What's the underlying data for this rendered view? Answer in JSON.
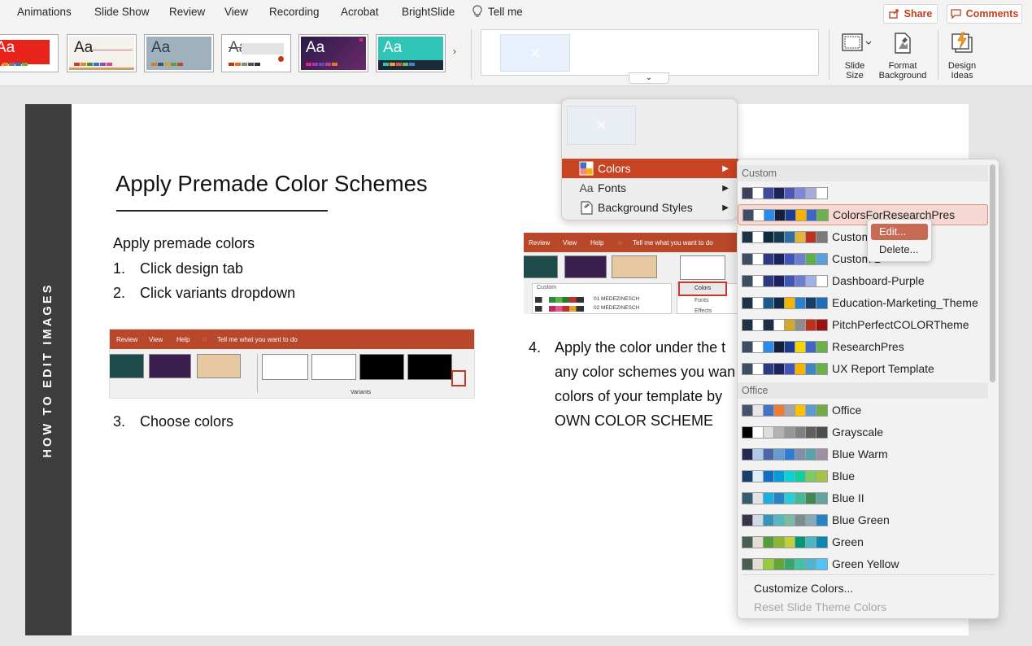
{
  "colors": {
    "accent": "#c43e1c",
    "menu_highlight": "#c84423",
    "slide_sidebar": "#3d3d3d"
  },
  "ribbon": {
    "tabs": [
      "Animations",
      "Slide Show",
      "Review",
      "View",
      "Recording",
      "Acrobat",
      "BrightSlide"
    ],
    "tell_me": "Tell me",
    "tell_me_icon": "lightbulb-icon",
    "share_label": "Share",
    "comments_label": "Comments",
    "slide_size": [
      "Slide",
      "Size"
    ],
    "format_background": [
      "Format",
      "Background"
    ],
    "design_ideas": [
      "Design",
      "Ideas"
    ],
    "theme_aa": "Aa"
  },
  "slide": {
    "sidebar_text": "HOW TO EDIT IMAGES",
    "title": "Apply Premade Color Schemes",
    "intro": "Apply premade colors",
    "steps": [
      {
        "num": "1.",
        "text": "Click design tab"
      },
      {
        "num": "2.",
        "text": "Click variants dropdown"
      },
      {
        "num": "3.",
        "text": "Choose colors"
      },
      {
        "num": "4.",
        "text": "Apply the color under the t"
      }
    ],
    "step4_lines": [
      "any color schemes you wan",
      "colors of your template by",
      "OWN COLOR SCHEME"
    ],
    "shot1": {
      "tabs": [
        "Review",
        "View",
        "Help"
      ],
      "tell_me": "Tell me what you want to do",
      "variants_label": "Variants"
    },
    "shot2": {
      "tabs": [
        "Review",
        "View",
        "Help"
      ],
      "tell_me": "Tell me what you want to do",
      "custom_label": "Custom",
      "rows": [
        "01 MEDEZINESCH",
        "02 MEDEZINESCH"
      ],
      "menu": [
        "Colors",
        "Fonts",
        "Effects"
      ]
    }
  },
  "popup_menu": {
    "items": [
      {
        "label": "Colors",
        "icon": "colors-icon"
      },
      {
        "label": "Fonts",
        "icon": "fonts-aa-icon",
        "icon_text": "Aa"
      },
      {
        "label": "Background Styles",
        "icon": "background-styles-icon"
      }
    ]
  },
  "colors_menu": {
    "custom_header": "Custom",
    "office_header": "Office",
    "custom": [
      {
        "name": "",
        "swatches": [
          "#3d3f5a",
          "#ffffff",
          "#3b4a9c",
          "#1c2356",
          "#4c57b7",
          "#7e86d6",
          "#a5acd9",
          "#ffffff"
        ]
      },
      {
        "name": "ColorsForResearchPres",
        "swatches": [
          "#3d4e63",
          "#ffffff",
          "#2a8ce8",
          "#14203f",
          "#1d3b8f",
          "#f5b400",
          "#3e67c5",
          "#6ab04c"
        ]
      },
      {
        "name": "Custom",
        "swatches": [
          "#1e3246",
          "#ffffff",
          "#0e2a3e",
          "#163a52",
          "#2e6e9e",
          "#e2b43c",
          "#c0311c",
          "#7a7a7a"
        ]
      },
      {
        "name": "Custom 2",
        "swatches": [
          "#3d4e63",
          "#ffffff",
          "#2c3a85",
          "#1b2260",
          "#3f55b8",
          "#6b7fd0",
          "#5fb04c",
          "#5aa0d8"
        ]
      },
      {
        "name": "Dashboard-Purple",
        "swatches": [
          "#3d4e63",
          "#ffffff",
          "#2c3a85",
          "#1b2260",
          "#3f55b8",
          "#6b7fd0",
          "#a1b1e6",
          "#ffffff"
        ]
      },
      {
        "name": "Education-Marketing_Theme",
        "swatches": [
          "#1e3246",
          "#ffffff",
          "#1e5a8c",
          "#0f2a4a",
          "#f5b400",
          "#2d7fd0",
          "#153e6a",
          "#1e6fb8"
        ]
      },
      {
        "name": "PitchPerfectCOLORTheme",
        "swatches": [
          "#1e3246",
          "#ffffff",
          "#1a3048",
          "#ffffff",
          "#d4a82c",
          "#8c8c8c",
          "#c0311c",
          "#a00f0f"
        ]
      },
      {
        "name": "ResearchPres",
        "swatches": [
          "#3d4e63",
          "#ffffff",
          "#2a8ce8",
          "#14203f",
          "#1d3b8f",
          "#f5d800",
          "#3e67c5",
          "#6ab04c"
        ]
      },
      {
        "name": "UX Report Template",
        "swatches": [
          "#3d4e63",
          "#ffffff",
          "#2c3a85",
          "#1b2260",
          "#3f55b8",
          "#f5b400",
          "#3e87c5",
          "#6ab04c"
        ]
      }
    ],
    "office": [
      {
        "name": "Office",
        "swatches": [
          "#44546a",
          "#e7e6e6",
          "#4472c4",
          "#ed7d31",
          "#a5a5a5",
          "#ffc000",
          "#5b9bd5",
          "#70ad47"
        ]
      },
      {
        "name": "Grayscale",
        "swatches": [
          "#000000",
          "#ffffff",
          "#dddddd",
          "#b2b2b2",
          "#969696",
          "#808080",
          "#5f5f5f",
          "#4d4d4d"
        ]
      },
      {
        "name": "Blue Warm",
        "swatches": [
          "#242852",
          "#acccea",
          "#4a66ac",
          "#629dd1",
          "#297fd5",
          "#7f8fa9",
          "#5aa2ae",
          "#9d90a0"
        ]
      },
      {
        "name": "Blue",
        "swatches": [
          "#17406d",
          "#dbeff9",
          "#0f6fc6",
          "#009dd9",
          "#0bd0d9",
          "#10cf9b",
          "#7cca62",
          "#a5c249"
        ]
      },
      {
        "name": "Blue II",
        "swatches": [
          "#335b74",
          "#dfe3e5",
          "#1cade4",
          "#2683c6",
          "#27ced7",
          "#42ba97",
          "#3e8853",
          "#62a39f"
        ]
      },
      {
        "name": "Blue Green",
        "swatches": [
          "#373545",
          "#cedbe6",
          "#3494ba",
          "#58b6c0",
          "#75bda7",
          "#7a8c8e",
          "#84acb6",
          "#2683c6"
        ]
      },
      {
        "name": "Green",
        "swatches": [
          "#455f51",
          "#e3ded1",
          "#549e39",
          "#8ab833",
          "#c0cf3a",
          "#029676",
          "#4ab5c4",
          "#0989b1"
        ]
      },
      {
        "name": "Green Yellow",
        "swatches": [
          "#455f51",
          "#e3ded1",
          "#99cb38",
          "#63a537",
          "#37a76f",
          "#44c1a3",
          "#4eb3cf",
          "#51c3f9"
        ]
      }
    ],
    "customize_label": "Customize Colors...",
    "reset_label": "Reset Slide Theme Colors"
  },
  "context_menu": {
    "edit_label": "Edit...",
    "delete_label": "Delete..."
  }
}
